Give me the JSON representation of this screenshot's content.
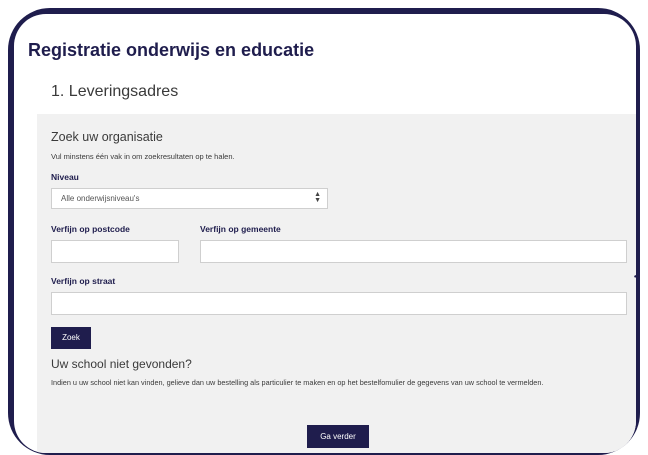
{
  "header": {
    "title": "Registratie onderwijs en educatie"
  },
  "section": {
    "title": "1. Leveringsadres"
  },
  "search": {
    "title": "Zoek uw organisatie",
    "hint": "Vul minstens één vak in om zoekresultaten op te halen.",
    "level_label": "Niveau",
    "level_value": "Alle onderwijsniveau's",
    "postcode_label": "Verfijn op postcode",
    "postcode_value": "",
    "municipality_label": "Verfijn op gemeente",
    "municipality_value": "",
    "street_label": "Verfijn op straat",
    "street_value": "",
    "search_button": "Zoek"
  },
  "not_found": {
    "title": "Uw school niet gevonden?",
    "text": "Indien u uw school niet kan vinden, gelieve dan uw bestelling als particulier te maken en op het bestelfomulier de gegevens van uw school te vermelden."
  },
  "footer": {
    "continue_button": "Ga verder"
  }
}
